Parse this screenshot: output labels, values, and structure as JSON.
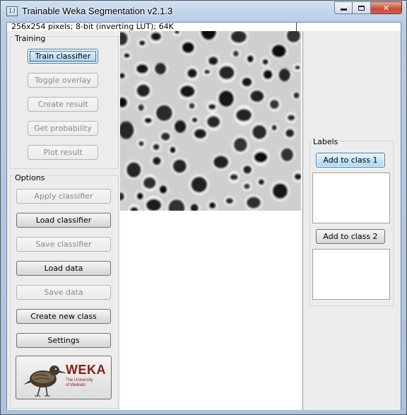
{
  "window": {
    "title": "Trainable Weka Segmentation v2.1.3",
    "icon": "imagej-window-icon",
    "minimize_glyph": "",
    "maximize_glyph": "",
    "close_glyph": "✕"
  },
  "image_info": "256x254 pixels; 8-bit (inverting LUT); 64K",
  "training": {
    "title": "Training",
    "buttons": [
      {
        "label": "Train classifier",
        "enabled": true,
        "default": true
      },
      {
        "label": "Toggle overlay",
        "enabled": false
      },
      {
        "label": "Create result",
        "enabled": false
      },
      {
        "label": "Get probability",
        "enabled": false
      },
      {
        "label": "Plot result",
        "enabled": false
      }
    ]
  },
  "options": {
    "title": "Options",
    "buttons": [
      {
        "label": "Apply classifier",
        "enabled": false
      },
      {
        "label": "Load classifier",
        "enabled": true
      },
      {
        "label": "Save classifier",
        "enabled": false
      },
      {
        "label": "Load data",
        "enabled": true
      },
      {
        "label": "Save data",
        "enabled": false
      },
      {
        "label": "Create new class",
        "enabled": true
      },
      {
        "label": "Settings",
        "enabled": true
      }
    ]
  },
  "logo": {
    "word": "WEKA",
    "subtitle_line1": "The University",
    "subtitle_line2": "of Waikato"
  },
  "labels": {
    "title": "Labels",
    "classes": [
      {
        "button_label": "Add to class 1",
        "focused": true
      },
      {
        "button_label": "Add to class 2",
        "focused": false
      }
    ]
  },
  "colors": {
    "logo_red": "#8b1a1a",
    "default_button_blue": "#a9d7f6",
    "close_button_red": "#c74c38"
  }
}
